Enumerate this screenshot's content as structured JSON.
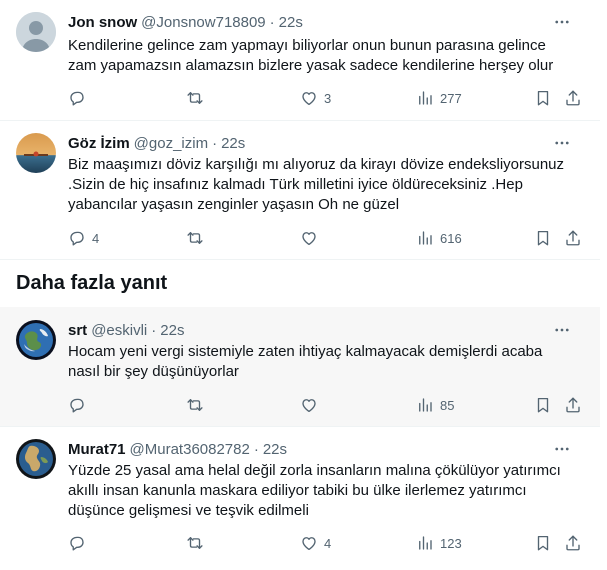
{
  "tweets": [
    {
      "name": "Jon snow",
      "handle": "@Jonsnow718809",
      "time": "22s",
      "lines": [
        "Kendilerine gelince zam yapmayı biliyorlar onun bunun parasına gelince",
        "zam yapamazsın alamazsın bizlere yasak sadece kendilerine herşey olur"
      ],
      "replies": "",
      "likes": "3",
      "views": "277"
    },
    {
      "name": "Göz İzim",
      "handle": "@goz_izim",
      "time": "22s",
      "lines": [
        "Biz maaşımızı döviz karşılığı mı alıyoruz da kirayı dövize endeksliyorsunuz",
        ".Sizin de hiç insafınız  kalmadı Türk milletini iyice öldüreceksiniz .Hep",
        "yabancılar yaşasın zenginler yaşasın Oh ne güzel"
      ],
      "replies": "4",
      "likes": "",
      "views": "616"
    },
    {
      "name": "srt",
      "handle": "@eskivli",
      "time": "22s",
      "lines": [
        "Hocam yeni vergi sistemiyle zaten ihtiyaç kalmayacak demişlerdi acaba",
        "nasıl bir şey düşünüyorlar"
      ],
      "replies": "",
      "likes": "",
      "views": "85"
    },
    {
      "name": "Murat71",
      "handle": "@Murat36082782",
      "time": "22s",
      "lines": [
        "Yüzde 25 yasal ama helal değil zorla insanların malına çökülüyor yatırımcı",
        "akıllı insan kanunla maskara ediliyor tabiki bu ülke ilerlemez yatırımcı",
        "düşünce gelişmesi ve teşvik edilmeli"
      ],
      "replies": "",
      "likes": "4",
      "views": "123"
    }
  ],
  "section": {
    "more_replies": "Daha fazla yanıt"
  },
  "icons": [
    "reply-icon",
    "retweet-icon",
    "like-icon",
    "views-icon",
    "bookmark-icon",
    "share-icon",
    "more-icon"
  ],
  "colors": {
    "text": "#0f1419",
    "muted": "#536471",
    "divider": "#eff3f4",
    "highlight_bg": "#f7f7f7"
  }
}
